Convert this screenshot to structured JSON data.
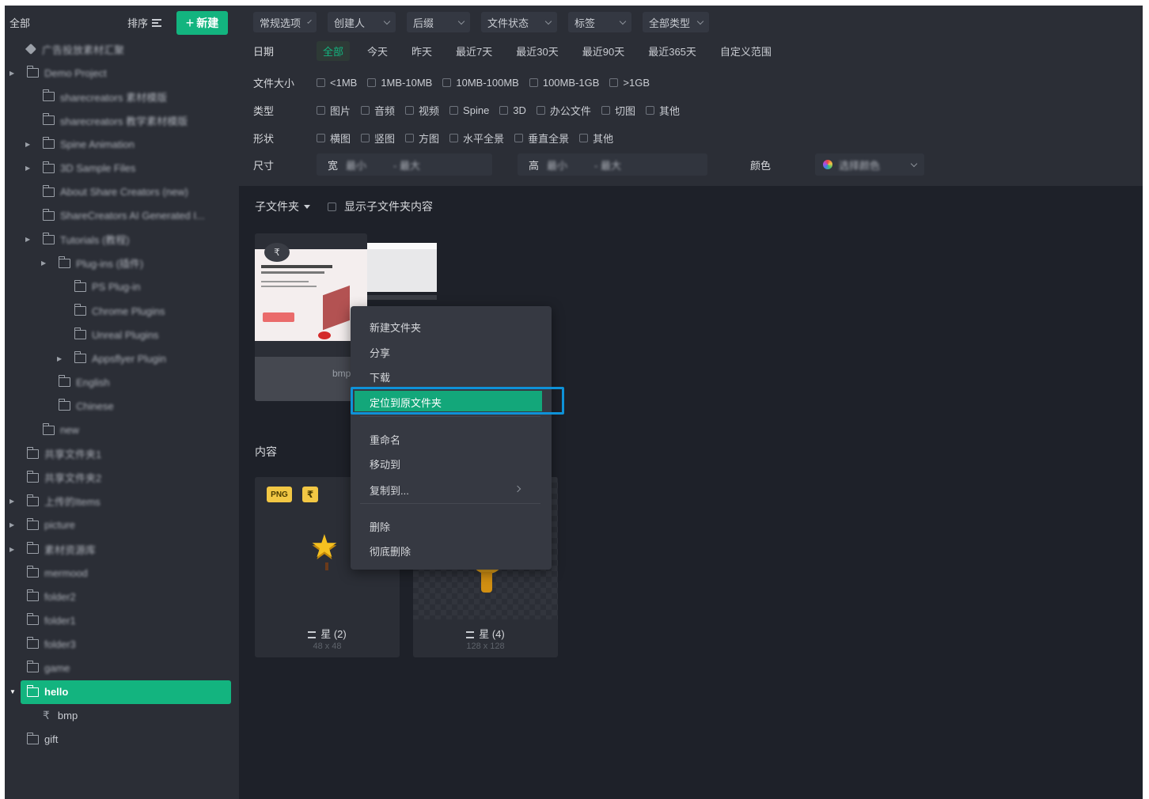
{
  "sidebar": {
    "all_label": "全部",
    "sort_label": "排序",
    "new_button": "新建",
    "items": [
      {
        "label": "广告投放素材汇聚",
        "indent": 0,
        "caret": false,
        "icon": "pin-icon",
        "blurred": true
      },
      {
        "label": "Demo Project",
        "indent": 0,
        "caret": true,
        "blurred": true
      },
      {
        "label": "sharecreators 素材模版",
        "indent": 1,
        "caret": false,
        "blurred": true
      },
      {
        "label": "sharecreators 教学素材模版",
        "indent": 1,
        "caret": false,
        "blurred": true
      },
      {
        "label": "Spine Animation",
        "indent": 1,
        "caret": true,
        "blurred": true
      },
      {
        "label": "3D Sample Files",
        "indent": 1,
        "caret": true,
        "blurred": true
      },
      {
        "label": "About Share Creators (new)",
        "indent": 1,
        "caret": false,
        "blurred": true
      },
      {
        "label": "ShareCreators AI Generated I...",
        "indent": 1,
        "caret": false,
        "blurred": true
      },
      {
        "label": "Tutorials (教程)",
        "indent": 1,
        "caret": true,
        "blurred": true
      },
      {
        "label": "Plug-ins (插件)",
        "indent": 2,
        "caret": true,
        "blurred": true
      },
      {
        "label": "PS Plug-in",
        "indent": 3,
        "caret": false,
        "blurred": true
      },
      {
        "label": "Chrome Plugins",
        "indent": 3,
        "caret": false,
        "blurred": true
      },
      {
        "label": "Unreal Plugins",
        "indent": 3,
        "caret": false,
        "blurred": true
      },
      {
        "label": "Appsflyer Plugin",
        "indent": 3,
        "caret": true,
        "blurred": true
      },
      {
        "label": "English",
        "indent": 2,
        "caret": false,
        "blurred": true
      },
      {
        "label": "Chinese",
        "indent": 2,
        "caret": false,
        "blurred": true
      },
      {
        "label": "new",
        "indent": 1,
        "caret": false,
        "blurred": true
      },
      {
        "label": "共享文件夹1",
        "indent": 0,
        "caret": false,
        "blurred": true
      },
      {
        "label": "共享文件夹2",
        "indent": 0,
        "caret": false,
        "blurred": true
      },
      {
        "label": "上传的Items",
        "indent": 0,
        "caret": true,
        "blurred": true
      },
      {
        "label": "picture",
        "indent": 0,
        "caret": true,
        "blurred": true
      },
      {
        "label": "素材资源库",
        "indent": 0,
        "caret": true,
        "blurred": true
      },
      {
        "label": "mermood",
        "indent": 0,
        "caret": false,
        "blurred": true
      },
      {
        "label": "folder2",
        "indent": 0,
        "caret": false,
        "blurred": true
      },
      {
        "label": "folder1",
        "indent": 0,
        "caret": false,
        "blurred": true
      },
      {
        "label": "folder3",
        "indent": 0,
        "caret": false,
        "blurred": true
      },
      {
        "label": "game",
        "indent": 0,
        "caret": false,
        "blurred": true
      },
      {
        "label": "hello",
        "indent": 0,
        "caret": true,
        "selected": true
      },
      {
        "label": "bmp",
        "indent": 1,
        "caret": false,
        "icon": "bmp-icon"
      },
      {
        "label": "gift",
        "indent": 0,
        "caret": false
      }
    ]
  },
  "filters": {
    "dropdowns": [
      "常规选项",
      "创建人",
      "后缀",
      "文件状态",
      "标签",
      "全部类型"
    ],
    "date": {
      "label": "日期",
      "options": [
        "全部",
        "今天",
        "昨天",
        "最近7天",
        "最近30天",
        "最近90天",
        "最近365天",
        "自定义范围"
      ],
      "active": 0
    },
    "filesize": {
      "label": "文件大小",
      "options": [
        "<1MB",
        "1MB-10MB",
        "10MB-100MB",
        "100MB-1GB",
        ">1GB"
      ]
    },
    "type": {
      "label": "类型",
      "options": [
        "图片",
        "音频",
        "视频",
        "Spine",
        "3D",
        "办公文件",
        "切图",
        "其他"
      ]
    },
    "shape": {
      "label": "形状",
      "options": [
        "横图",
        "竖图",
        "方图",
        "水平全景",
        "垂直全景",
        "其他"
      ]
    },
    "size": {
      "label": "尺寸",
      "width_label": "宽",
      "height_label": "高",
      "min_placeholder": "最小",
      "max_placeholder": "- 最大"
    },
    "color": {
      "label": "颜色",
      "placeholder": "选择颜色"
    }
  },
  "main": {
    "subfolder_label": "子文件夹",
    "show_subfolder_content": "显示子文件夹内容",
    "content_label": "内容",
    "folder_card": {
      "name": "bmp",
      "badge": "₹"
    },
    "assets": [
      {
        "tag": "PNG",
        "icon_tag": "₹",
        "name": "星 (2)",
        "dims": "48 x 48"
      },
      {
        "name": "星 (4)",
        "dims": "128 x 128"
      }
    ]
  },
  "context_menu": {
    "items": [
      "新建文件夹",
      "分享",
      "下载",
      "定位到原文件夹",
      "重命名",
      "移动到",
      "复制到...",
      "删除",
      "彻底删除"
    ],
    "highlighted_index": 3
  },
  "colors": {
    "accent": "#13b47f",
    "highlight_border": "#0e92d8",
    "panel": "#2b2e36",
    "background": "#1e2129"
  }
}
